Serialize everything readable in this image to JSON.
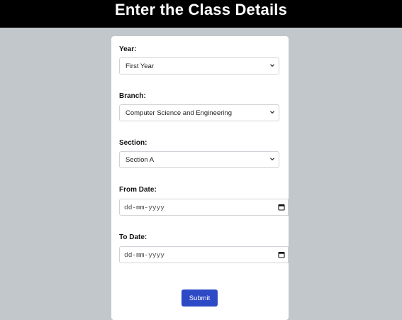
{
  "header": {
    "title": "Enter the Class Details"
  },
  "form": {
    "year": {
      "label": "Year:",
      "value": "First Year"
    },
    "branch": {
      "label": "Branch:",
      "value": "Computer Science and Engineering"
    },
    "section": {
      "label": "Section:",
      "value": "Section A"
    },
    "from_date": {
      "label": "From Date:",
      "placeholder": "dd-mm-yyyy"
    },
    "to_date": {
      "label": "To Date:",
      "placeholder": "dd-mm-yyyy"
    },
    "submit_label": "Submit"
  },
  "colors": {
    "header_bg": "#000000",
    "page_bg": "#c2c7cc",
    "submit_bg": "#2d49c6"
  }
}
